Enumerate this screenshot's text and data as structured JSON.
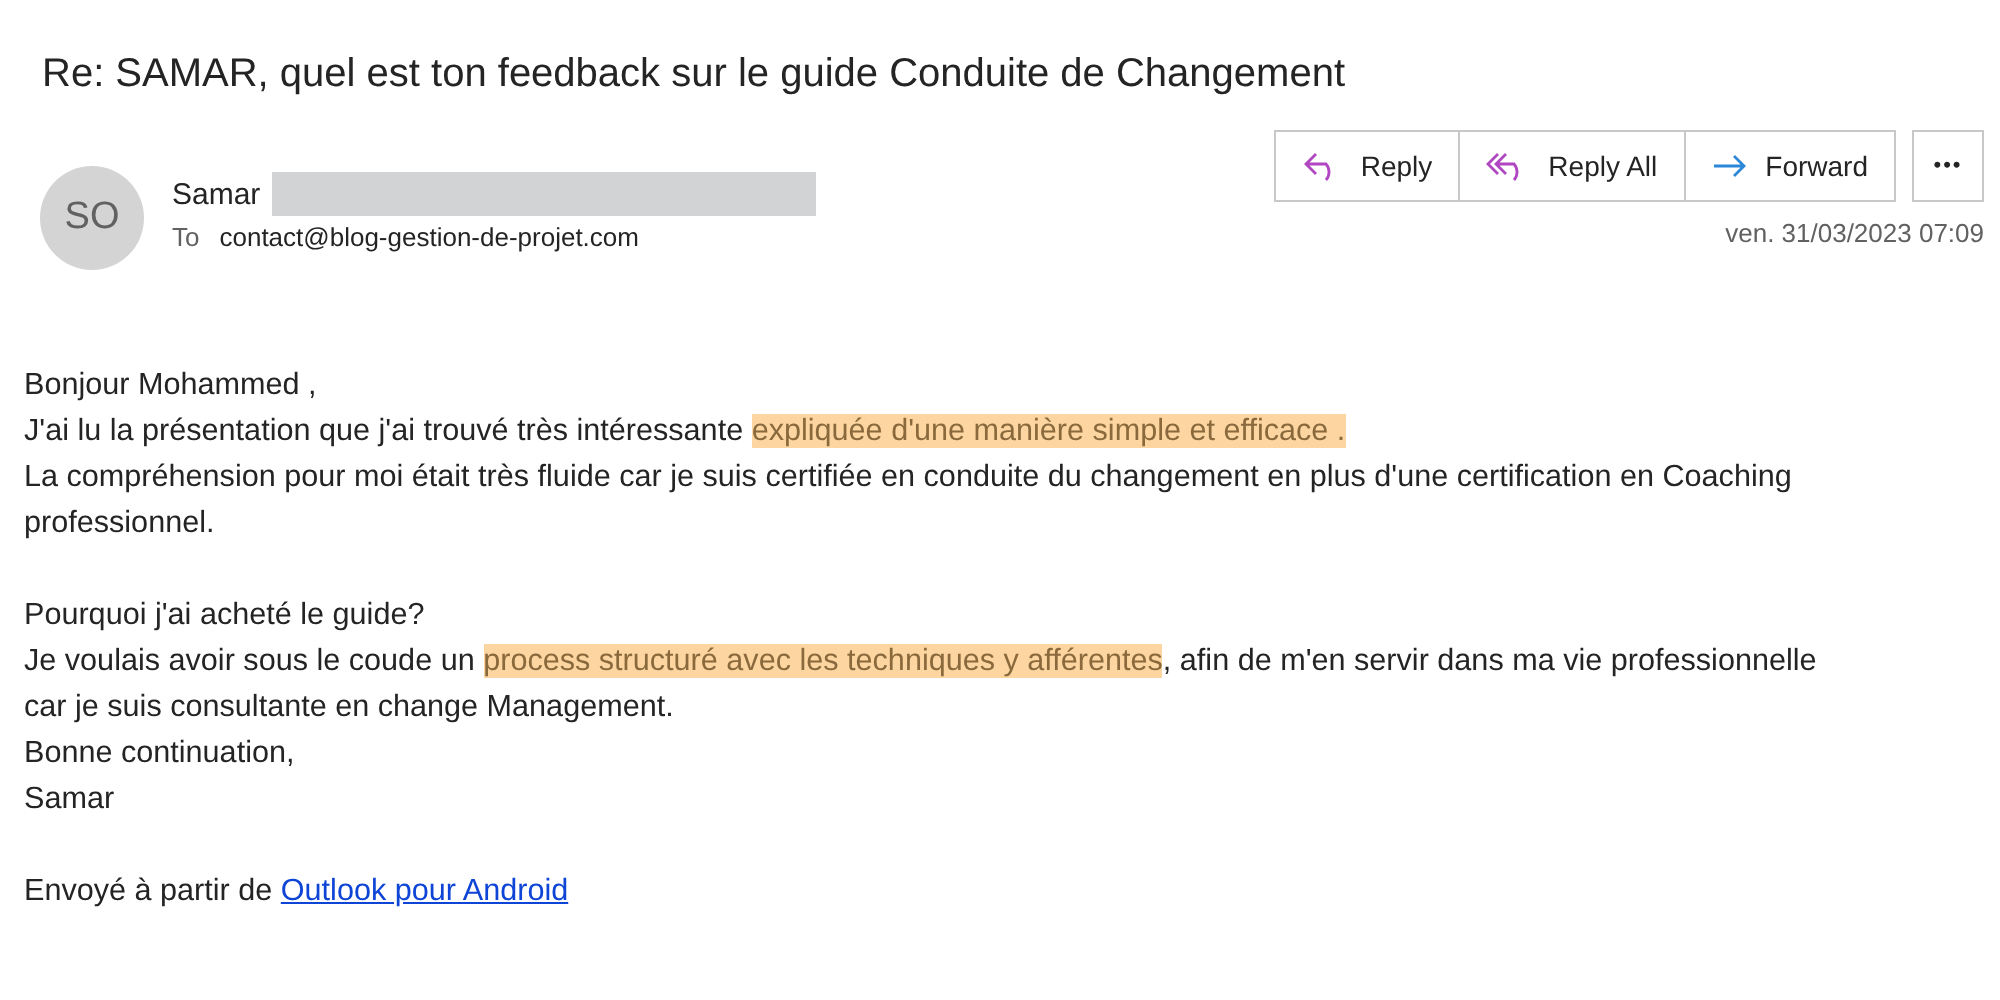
{
  "subject": "Re: SAMAR, quel est ton feedback sur le guide Conduite de Changement",
  "sender": {
    "initials": "SO",
    "name": "Samar",
    "to_label": "To",
    "to": "contact@blog-gestion-de-projet.com",
    "date": "ven. 31/03/2023 07:09"
  },
  "actions": [
    {
      "kind": "reply",
      "label": "Reply"
    },
    {
      "kind": "reply_all",
      "label": "Reply All"
    },
    {
      "kind": "forward",
      "label": "Forward"
    },
    {
      "kind": "more",
      "label": "•••"
    }
  ],
  "body": [
    [
      [
        {
          "text": "Bonjour Mohammed ,",
          "highlighted": false
        }
      ],
      [
        {
          "text": "J'ai lu la présentation que j'ai trouvé très intéressante ",
          "highlighted": false
        },
        {
          "text": "expliquée d'une manière simple et efficace .",
          "highlighted": true
        }
      ],
      [
        {
          "text": "La compréhension pour moi était très fluide car je suis certifiée en conduite du changement en plus d'une certification en Coaching",
          "highlighted": false
        }
      ],
      [
        {
          "text": "professionnel.",
          "highlighted": false
        }
      ]
    ],
    [
      [
        {
          "text": "Pourquoi j'ai acheté le guide?",
          "highlighted": false
        }
      ],
      [
        {
          "text": "Je voulais avoir sous le coude un ",
          "highlighted": false
        },
        {
          "text": "process structuré avec les techniques y afférentes",
          "highlighted": true
        },
        {
          "text": ", afin de m'en servir dans ma vie professionnelle",
          "highlighted": false
        }
      ],
      [
        {
          "text": "car je suis consultante en change Management.",
          "highlighted": false
        }
      ],
      [
        {
          "text": "Bonne continuation,",
          "highlighted": false
        }
      ],
      [
        {
          "text": "Samar",
          "highlighted": false
        }
      ]
    ]
  ],
  "signature": {
    "prefix": "Envoyé à partir de ",
    "link": "Outlook pour Android"
  }
}
